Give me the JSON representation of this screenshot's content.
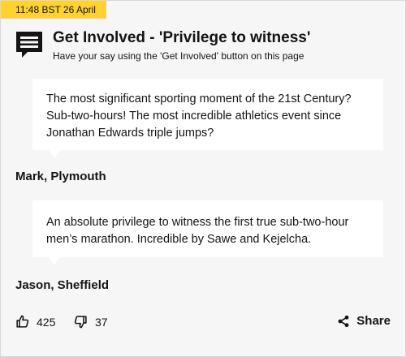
{
  "timestamp": "11:48 BST 26 April",
  "header": {
    "icon": "comment-icon",
    "title": "Get Involved - 'Privilege to witness'",
    "subtitle": "Have your say using the 'Get Involved' button on this page"
  },
  "comments": [
    {
      "text": "The most significant sporting moment of the 21st Century? Sub-two-hours! The most incredible athletics event since Jonathan Edwards triple jumps?",
      "author": "Mark, Plymouth"
    },
    {
      "text": "An absolute privilege to witness the first true sub-two-hour men’s marathon. Incredible by Sawe and Kejelcha.",
      "author": "Jason, Sheffield"
    }
  ],
  "reactions": {
    "like_icon": "thumbs-up-icon",
    "like_count": "425",
    "dislike_icon": "thumbs-down-icon",
    "dislike_count": "37",
    "share_icon": "share-icon",
    "share_label": "Share"
  },
  "colors": {
    "timestamp_bg": "#ffd230",
    "text": "#141414",
    "background": "#f6f6f6",
    "quote_bg": "#ffffff"
  }
}
